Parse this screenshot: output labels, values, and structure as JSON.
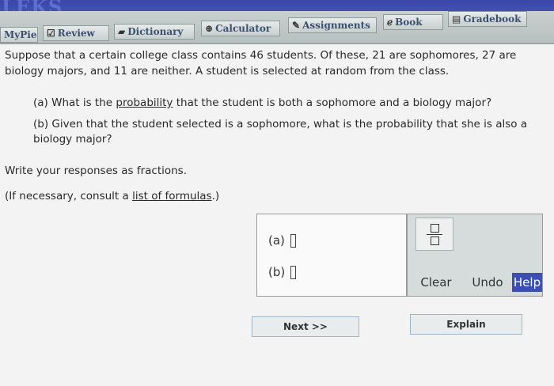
{
  "brand": {
    "logo_text": "LEKS"
  },
  "toolbar": {
    "tabs": [
      {
        "label": "MyPie",
        "icon": ""
      },
      {
        "label": "Review",
        "icon": "checkmark-icon"
      },
      {
        "label": "Dictionary",
        "icon": "book-icon"
      },
      {
        "label": "Calculator",
        "icon": "calculator-icon"
      },
      {
        "label": "Assignments",
        "icon": "pencil-icon"
      },
      {
        "label": "Book",
        "icon": "e-book-icon"
      },
      {
        "label": "Gradebook",
        "icon": "gradebook-icon"
      }
    ]
  },
  "question": {
    "intro": "Suppose that a certain college class contains 46 students. Of these, 21 are sophomores, 27 are biology majors, and 11 are neither. A student is selected at random from the class.",
    "part_a_prefix": "(a) What is the ",
    "part_a_link": "probability",
    "part_a_suffix": " that the student is both a sophomore and a biology major?",
    "part_b": "(b) Given that the student selected is a sophomore, what is the probability that she is also a biology major?",
    "instructions": "Write your responses as fractions.",
    "consult_prefix": "(If necessary, consult a ",
    "consult_link": "list of formulas",
    "consult_suffix": ".)"
  },
  "answer": {
    "label_a": "(a)",
    "label_b": "(b)"
  },
  "tools": {
    "clear_label": "Clear",
    "undo_label": "Undo",
    "help_label": "Help"
  },
  "nav": {
    "next_label": "Next >>",
    "explain_label": "Explain"
  },
  "colors": {
    "brand_blue": "#3a47a8",
    "help_bg": "#3c4fb2"
  }
}
